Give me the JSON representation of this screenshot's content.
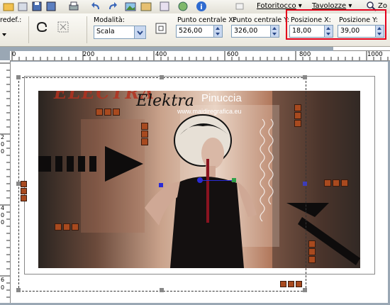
{
  "menu": {
    "items": [
      {
        "label": "Fotoritocco",
        "underline": "F"
      },
      {
        "label": "Tavolozze",
        "underline": "T"
      },
      {
        "label": "Zo",
        "underline": ""
      }
    ]
  },
  "options": {
    "preset_label": "redef.:",
    "mode_label": "Modalità:",
    "mode_value": "Scala",
    "center_x_label": "Punto centrale X:",
    "center_x_value": "526,00",
    "center_y_label": "Punto centrale Y:",
    "center_y_value": "326,00",
    "pos_x_label": "Posizione X:",
    "pos_x_value": "18,00",
    "pos_y_label": "Posizione Y:",
    "pos_y_value": "39,00"
  },
  "ruler": {
    "h_labels": [
      "0",
      "200",
      "400",
      "600",
      "800",
      "1000"
    ],
    "v_labels": [
      "2",
      "0",
      "0",
      "4",
      "0",
      "0",
      "6",
      "0"
    ]
  },
  "artwork": {
    "title_big": "ELECTRA",
    "title_script": "Elektra",
    "author": "Pinuccia",
    "website": "www.maidiregrafica.eu"
  },
  "colors": {
    "highlight": "#e4001b",
    "toolbar": "#ecebe4",
    "workspace": "#9aa7b4"
  }
}
